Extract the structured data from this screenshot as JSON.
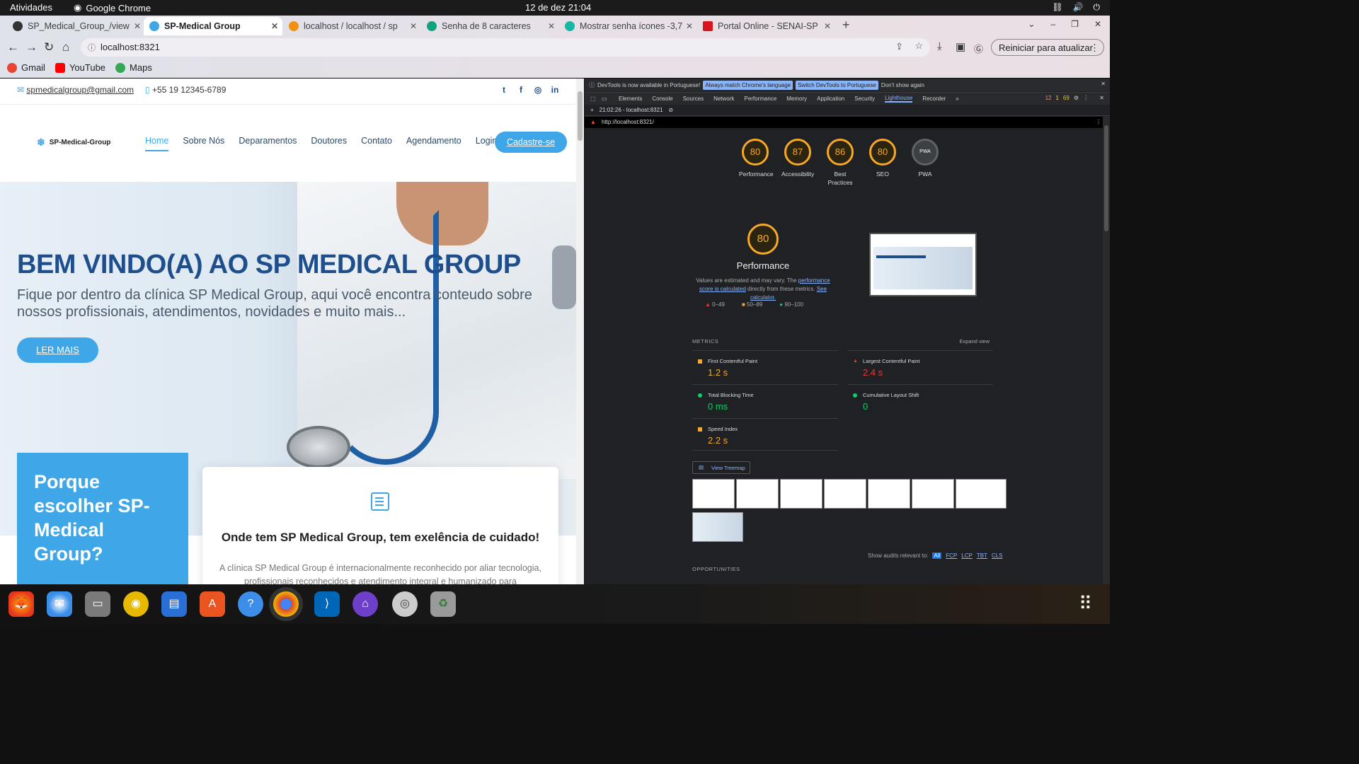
{
  "system": {
    "activities": "Atividades",
    "app": "Google Chrome",
    "clock": "12 de dez  21:04"
  },
  "tabs": [
    {
      "label": "SP_Medical_Group_/view",
      "color": "#333333"
    },
    {
      "label": "SP-Medical Group",
      "color": "#3fa7e8"
    },
    {
      "label": "localhost / localhost / sp",
      "color": "#f29111"
    },
    {
      "label": "Senha de 8 caracteres",
      "color": "#10a37f"
    },
    {
      "label": "Mostrar senha ícones -3,7",
      "color": "#18b6a5"
    },
    {
      "label": "Portal Online - SENAI-SP",
      "color": "#d6151d"
    }
  ],
  "browser": {
    "url": "localhost:8321",
    "update_label": "Reiniciar para atualizar"
  },
  "bookmarks": [
    {
      "label": "Gmail",
      "color": "#ea4335"
    },
    {
      "label": "YouTube",
      "color": "#ff0000"
    },
    {
      "label": "Maps",
      "color": "#34a853"
    }
  ],
  "site": {
    "email": "spmedicalgroup@gmail.com",
    "phone": "+55 19 12345-6789",
    "logo": "SP-Medical-Group",
    "nav": [
      "Home",
      "Sobre Nós",
      "Deparamentos",
      "Doutores",
      "Contato",
      "Agendamento",
      "Login"
    ],
    "cta": "Cadastre-se",
    "hero_title": "BEM VINDO(A) AO SP MEDICAL GROUP",
    "hero_sub": "Fique por dentro da clínica SP Medical Group, aqui você encontra conteudo sobre nossos profissionais, atendimentos, novidades e muito mais...",
    "hero_button": "LER MAIS",
    "why": "Porque escolher SP-Medical Group?",
    "card_title": "Onde tem SP Medical Group, tem exelência de cuidado!",
    "card_desc": "A clínica SP Medical Group é internacionalmente reconhecido por aliar tecnologia, profissionais reconhecidos e atendimento integral e humanizado para",
    "accent": "#3fa7e8",
    "brand": "#1e4e8c"
  },
  "devtools": {
    "notice": "DevTools is now available in Portuguese!",
    "btn_match": "Always match Chrome's language",
    "btn_switch": "Switch DevTools to Portuguese",
    "btn_dismiss": "Don't show again",
    "panels": [
      "Elements",
      "Console",
      "Sources",
      "Network",
      "Performance",
      "Memory",
      "Application",
      "Security",
      "Lighthouse",
      "Recorder"
    ],
    "issues": {
      "errors": "12",
      "warnings": "1",
      "info": "69"
    },
    "run": "21:02:26 - localhost:8321",
    "report_url": "http://localhost:8321/",
    "scores": [
      {
        "value": "80",
        "label": "Performance"
      },
      {
        "value": "87",
        "label": "Accessibility"
      },
      {
        "value": "86",
        "label": "Best Practices"
      },
      {
        "value": "80",
        "label": "SEO"
      },
      {
        "value": "PWA",
        "label": "PWA"
      }
    ],
    "perf_score": "80",
    "perf_title": "Performance",
    "perf_note_1": "Values are estimated and may vary. The",
    "perf_note_link": "performance score is calculated",
    "perf_note_2": "directly from these metrics.",
    "perf_note_calc": "See calculator.",
    "legend": [
      "0–49",
      "50–89",
      "90–100"
    ],
    "metrics_label": "METRICS",
    "expand": "Expand view",
    "metrics": [
      {
        "name": "First Contentful Paint",
        "value": "1.2 s",
        "color": "#f9a825"
      },
      {
        "name": "Largest Contentful Paint",
        "value": "2.4 s",
        "color": "#e53935"
      },
      {
        "name": "Total Blocking Time",
        "value": "0 ms",
        "color": "#0cce6b"
      },
      {
        "name": "Cumulative Layout Shift",
        "value": "0",
        "color": "#0cce6b"
      },
      {
        "name": "Speed Index",
        "value": "2.2 s",
        "color": "#f9a825"
      }
    ],
    "treemap": "View Treemap",
    "show_audits": "Show audits relevant to:",
    "audit_filters": [
      "All",
      "FCP",
      "LCP",
      "TBT",
      "CLS"
    ],
    "opportunities": "OPPORTUNITIES"
  }
}
